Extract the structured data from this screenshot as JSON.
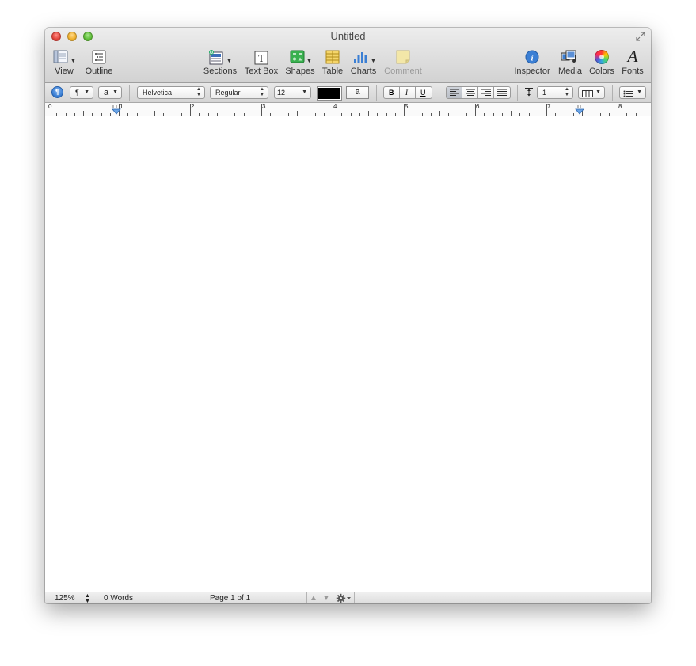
{
  "window": {
    "title": "Untitled"
  },
  "toolbar": {
    "view": "View",
    "outline": "Outline",
    "sections": "Sections",
    "text_box": "Text Box",
    "shapes": "Shapes",
    "table": "Table",
    "charts": "Charts",
    "comment": "Comment",
    "inspector": "Inspector",
    "media": "Media",
    "colors": "Colors",
    "fonts": "Fonts",
    "fonts_glyph": "A"
  },
  "format_bar": {
    "paragraph_style": "¶",
    "character_style": "a",
    "font_family": "Helvetica",
    "font_typeface": "Regular",
    "font_size": "12",
    "highlight_glyph": "a",
    "bold": "B",
    "italic": "I",
    "underline": "U",
    "line_spacing": "1",
    "text_color": "#000000"
  },
  "ruler": {
    "numbers": [
      "0",
      "1",
      "2",
      "3",
      "4",
      "5",
      "6",
      "7",
      "8"
    ]
  },
  "status_bar": {
    "zoom": "125%",
    "word_count": "0 Words",
    "page_info": "Page 1 of 1"
  },
  "colors": {
    "accent_blue": "#3b7fd4",
    "traffic_close": "#e2453c",
    "traffic_minimize": "#f0b02c",
    "traffic_zoom": "#5fbf3a"
  }
}
